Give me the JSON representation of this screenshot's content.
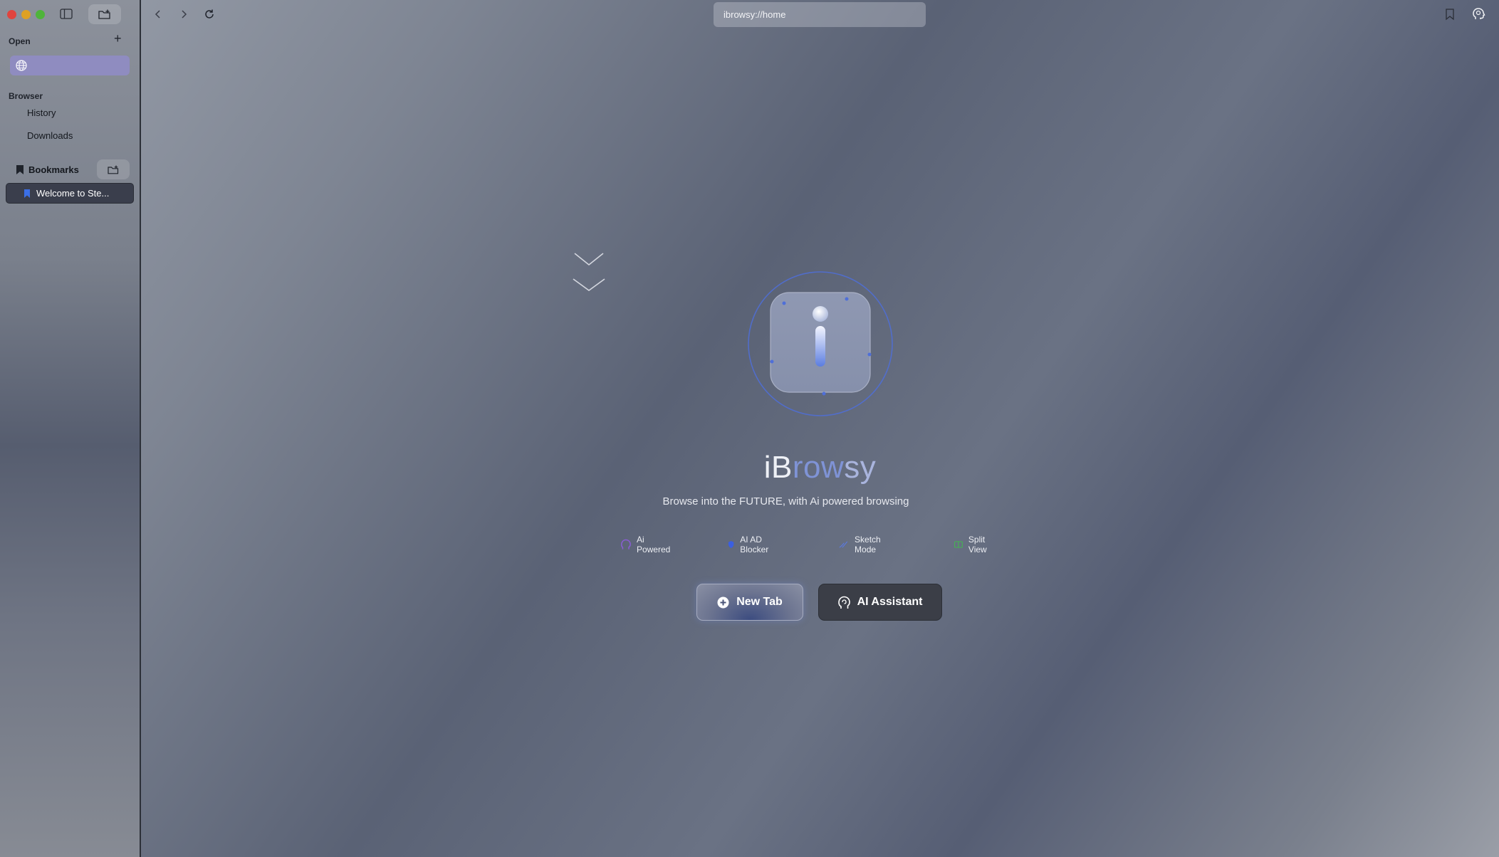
{
  "sidebar": {
    "open_label": "Open",
    "browser_label": "Browser",
    "history_label": "History",
    "downloads_label": "Downloads",
    "bookmarks_label": "Bookmarks",
    "bookmark_items": [
      {
        "label": "Welcome to Ste..."
      }
    ]
  },
  "toolbar": {
    "url": "ibrowsy://home"
  },
  "main": {
    "title_parts": [
      "iB",
      "row",
      "sy"
    ],
    "subtitle": "Browse into the FUTURE, with Ai powered browsing",
    "features": [
      {
        "label": "Ai Powered",
        "icon": "brain-icon"
      },
      {
        "label": "AI AD Blocker",
        "icon": "shield-icon"
      },
      {
        "label": "Sketch Mode",
        "icon": "pencil-icon"
      },
      {
        "label": "Split View",
        "icon": "split-view-icon"
      }
    ],
    "new_tab_label": "New Tab",
    "ai_assistant_label": "AI Assistant"
  },
  "colors": {
    "accent": "#7f93d6",
    "bookmark_blue": "#3b6fe6",
    "open_tab_bg": "#8f8cc0",
    "ai_powered": "#8a5cd8",
    "ad_blocker": "#3b5fe0",
    "sketch": "#5a7ae6",
    "split_view": "#3fbf4a"
  }
}
